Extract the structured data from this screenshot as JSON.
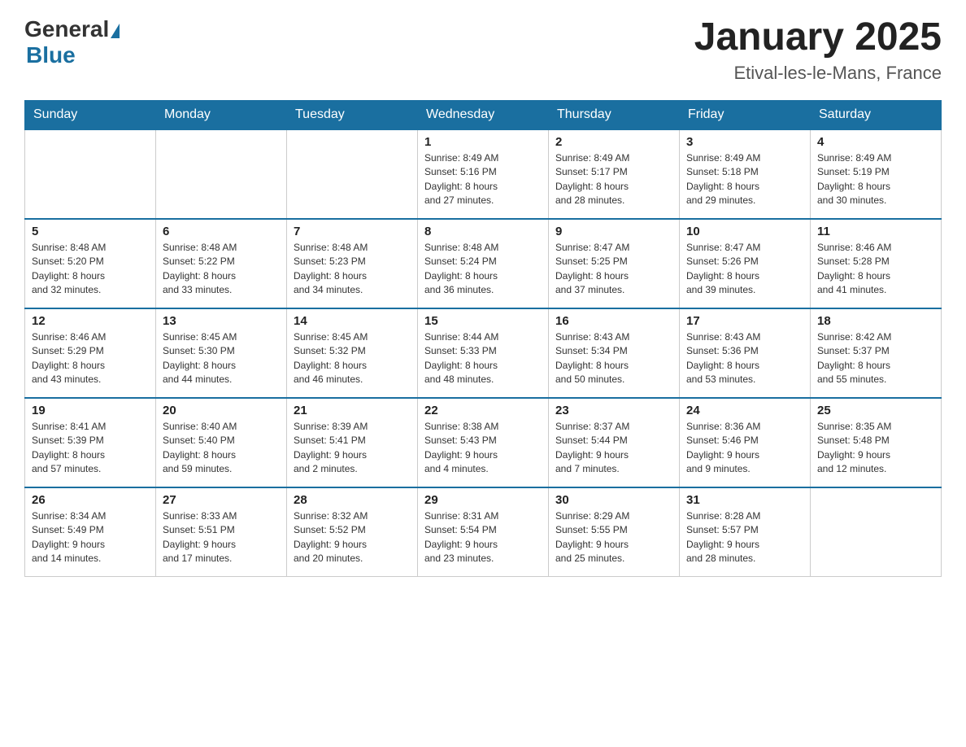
{
  "header": {
    "logo": {
      "general": "General",
      "triangle": "▲",
      "blue": "Blue"
    },
    "title": "January 2025",
    "location": "Etival-les-le-Mans, France"
  },
  "days_of_week": [
    "Sunday",
    "Monday",
    "Tuesday",
    "Wednesday",
    "Thursday",
    "Friday",
    "Saturday"
  ],
  "weeks": [
    [
      {
        "day": "",
        "info": ""
      },
      {
        "day": "",
        "info": ""
      },
      {
        "day": "",
        "info": ""
      },
      {
        "day": "1",
        "info": "Sunrise: 8:49 AM\nSunset: 5:16 PM\nDaylight: 8 hours\nand 27 minutes."
      },
      {
        "day": "2",
        "info": "Sunrise: 8:49 AM\nSunset: 5:17 PM\nDaylight: 8 hours\nand 28 minutes."
      },
      {
        "day": "3",
        "info": "Sunrise: 8:49 AM\nSunset: 5:18 PM\nDaylight: 8 hours\nand 29 minutes."
      },
      {
        "day": "4",
        "info": "Sunrise: 8:49 AM\nSunset: 5:19 PM\nDaylight: 8 hours\nand 30 minutes."
      }
    ],
    [
      {
        "day": "5",
        "info": "Sunrise: 8:48 AM\nSunset: 5:20 PM\nDaylight: 8 hours\nand 32 minutes."
      },
      {
        "day": "6",
        "info": "Sunrise: 8:48 AM\nSunset: 5:22 PM\nDaylight: 8 hours\nand 33 minutes."
      },
      {
        "day": "7",
        "info": "Sunrise: 8:48 AM\nSunset: 5:23 PM\nDaylight: 8 hours\nand 34 minutes."
      },
      {
        "day": "8",
        "info": "Sunrise: 8:48 AM\nSunset: 5:24 PM\nDaylight: 8 hours\nand 36 minutes."
      },
      {
        "day": "9",
        "info": "Sunrise: 8:47 AM\nSunset: 5:25 PM\nDaylight: 8 hours\nand 37 minutes."
      },
      {
        "day": "10",
        "info": "Sunrise: 8:47 AM\nSunset: 5:26 PM\nDaylight: 8 hours\nand 39 minutes."
      },
      {
        "day": "11",
        "info": "Sunrise: 8:46 AM\nSunset: 5:28 PM\nDaylight: 8 hours\nand 41 minutes."
      }
    ],
    [
      {
        "day": "12",
        "info": "Sunrise: 8:46 AM\nSunset: 5:29 PM\nDaylight: 8 hours\nand 43 minutes."
      },
      {
        "day": "13",
        "info": "Sunrise: 8:45 AM\nSunset: 5:30 PM\nDaylight: 8 hours\nand 44 minutes."
      },
      {
        "day": "14",
        "info": "Sunrise: 8:45 AM\nSunset: 5:32 PM\nDaylight: 8 hours\nand 46 minutes."
      },
      {
        "day": "15",
        "info": "Sunrise: 8:44 AM\nSunset: 5:33 PM\nDaylight: 8 hours\nand 48 minutes."
      },
      {
        "day": "16",
        "info": "Sunrise: 8:43 AM\nSunset: 5:34 PM\nDaylight: 8 hours\nand 50 minutes."
      },
      {
        "day": "17",
        "info": "Sunrise: 8:43 AM\nSunset: 5:36 PM\nDaylight: 8 hours\nand 53 minutes."
      },
      {
        "day": "18",
        "info": "Sunrise: 8:42 AM\nSunset: 5:37 PM\nDaylight: 8 hours\nand 55 minutes."
      }
    ],
    [
      {
        "day": "19",
        "info": "Sunrise: 8:41 AM\nSunset: 5:39 PM\nDaylight: 8 hours\nand 57 minutes."
      },
      {
        "day": "20",
        "info": "Sunrise: 8:40 AM\nSunset: 5:40 PM\nDaylight: 8 hours\nand 59 minutes."
      },
      {
        "day": "21",
        "info": "Sunrise: 8:39 AM\nSunset: 5:41 PM\nDaylight: 9 hours\nand 2 minutes."
      },
      {
        "day": "22",
        "info": "Sunrise: 8:38 AM\nSunset: 5:43 PM\nDaylight: 9 hours\nand 4 minutes."
      },
      {
        "day": "23",
        "info": "Sunrise: 8:37 AM\nSunset: 5:44 PM\nDaylight: 9 hours\nand 7 minutes."
      },
      {
        "day": "24",
        "info": "Sunrise: 8:36 AM\nSunset: 5:46 PM\nDaylight: 9 hours\nand 9 minutes."
      },
      {
        "day": "25",
        "info": "Sunrise: 8:35 AM\nSunset: 5:48 PM\nDaylight: 9 hours\nand 12 minutes."
      }
    ],
    [
      {
        "day": "26",
        "info": "Sunrise: 8:34 AM\nSunset: 5:49 PM\nDaylight: 9 hours\nand 14 minutes."
      },
      {
        "day": "27",
        "info": "Sunrise: 8:33 AM\nSunset: 5:51 PM\nDaylight: 9 hours\nand 17 minutes."
      },
      {
        "day": "28",
        "info": "Sunrise: 8:32 AM\nSunset: 5:52 PM\nDaylight: 9 hours\nand 20 minutes."
      },
      {
        "day": "29",
        "info": "Sunrise: 8:31 AM\nSunset: 5:54 PM\nDaylight: 9 hours\nand 23 minutes."
      },
      {
        "day": "30",
        "info": "Sunrise: 8:29 AM\nSunset: 5:55 PM\nDaylight: 9 hours\nand 25 minutes."
      },
      {
        "day": "31",
        "info": "Sunrise: 8:28 AM\nSunset: 5:57 PM\nDaylight: 9 hours\nand 28 minutes."
      },
      {
        "day": "",
        "info": ""
      }
    ]
  ]
}
